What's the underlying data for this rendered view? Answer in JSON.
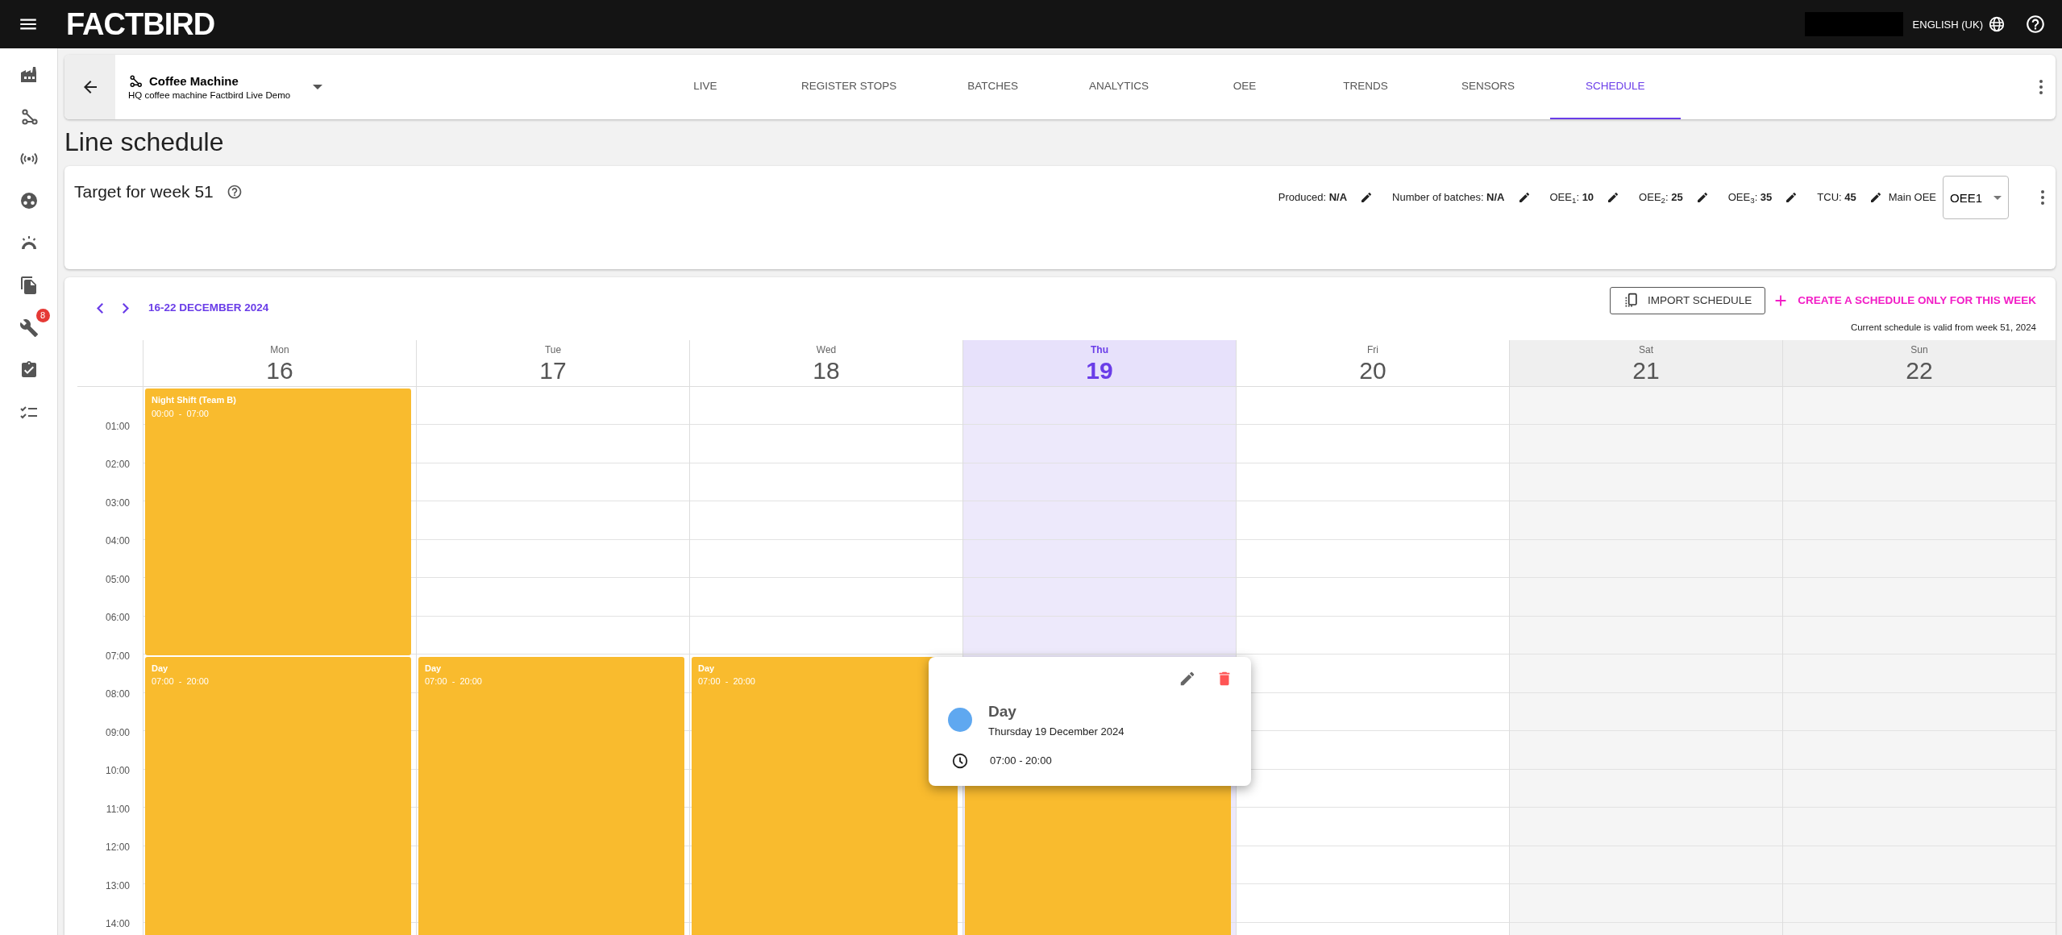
{
  "top_bar": {
    "logo": "FACTBIRD",
    "language": "ENGLISH (UK)"
  },
  "sidebar": {
    "items": [
      {
        "kind": "factory"
      },
      {
        "kind": "nodes"
      },
      {
        "kind": "broadcast"
      },
      {
        "kind": "reel"
      },
      {
        "kind": "gauge"
      },
      {
        "kind": "documents"
      },
      {
        "kind": "wrench",
        "badge": "8"
      },
      {
        "kind": "clipboard"
      },
      {
        "kind": "checklist"
      }
    ]
  },
  "line_header": {
    "name": "Coffee Machine",
    "subtitle": "HQ coffee machine Factbird Live Demo",
    "tabs": [
      {
        "label": "LIVE",
        "selected": false
      },
      {
        "label": "REGISTER STOPS",
        "selected": false
      },
      {
        "label": "BATCHES",
        "selected": false
      },
      {
        "label": "ANALYTICS",
        "selected": false
      },
      {
        "label": "OEE",
        "selected": false
      },
      {
        "label": "TRENDS",
        "selected": false
      },
      {
        "label": "SENSORS",
        "selected": false
      },
      {
        "label": "SCHEDULE",
        "selected": true
      }
    ]
  },
  "page_title": "Line schedule",
  "targets": {
    "title": "Target for week 51",
    "metrics": [
      "Produced: **N/A**",
      "Number of batches: **N/A**",
      "OEE$_{1}$: **10**",
      "OEE$_{2}$: **25**",
      "OEE$_{3}$: **35**",
      "TCU: **45**"
    ],
    "main_oee_label": "Main OEE",
    "main_oee_value": "OEE1"
  },
  "calendar": {
    "range": "16-22 DECEMBER 2024",
    "import_button": "IMPORT SCHEDULE",
    "create_link": "CREATE A SCHEDULE ONLY FOR THIS WEEK",
    "validity_note": "Current schedule is valid from week 51, 2024",
    "hours": [
      "01:00",
      "02:00",
      "03:00",
      "04:00",
      "05:00",
      "06:00",
      "07:00",
      "08:00",
      "09:00",
      "10:00",
      "11:00",
      "12:00",
      "13:00",
      "14:00"
    ],
    "days": [
      {
        "weekday": "Mon",
        "date": "16",
        "today": false,
        "weekend": false,
        "events": [
          {
            "kind": "night",
            "title": "Night Shift (Team B)",
            "time": "00:00  -  07:00"
          },
          {
            "kind": "day",
            "title": "Day",
            "time": "07:00  -  20:00"
          }
        ]
      },
      {
        "weekday": "Tue",
        "date": "17",
        "today": false,
        "weekend": false,
        "events": [
          {
            "kind": "day",
            "title": "Day",
            "time": "07:00  -  20:00"
          }
        ]
      },
      {
        "weekday": "Wed",
        "date": "18",
        "today": false,
        "weekend": false,
        "events": [
          {
            "kind": "day",
            "title": "Day",
            "time": "07:00  -  20:00"
          }
        ]
      },
      {
        "weekday": "Thu",
        "date": "19",
        "today": true,
        "weekend": false,
        "events": [
          {
            "kind": "day"
          }
        ]
      },
      {
        "weekday": "Fri",
        "date": "20",
        "today": false,
        "weekend": false
      },
      {
        "weekday": "Sat",
        "date": "21",
        "today": false,
        "weekend": true
      },
      {
        "weekday": "Sun",
        "date": "22",
        "today": false,
        "weekend": true
      }
    ],
    "popup": {
      "title": "Day",
      "date": "Thursday 19 December 2024",
      "time": "07:00 - 20:00"
    }
  }
}
